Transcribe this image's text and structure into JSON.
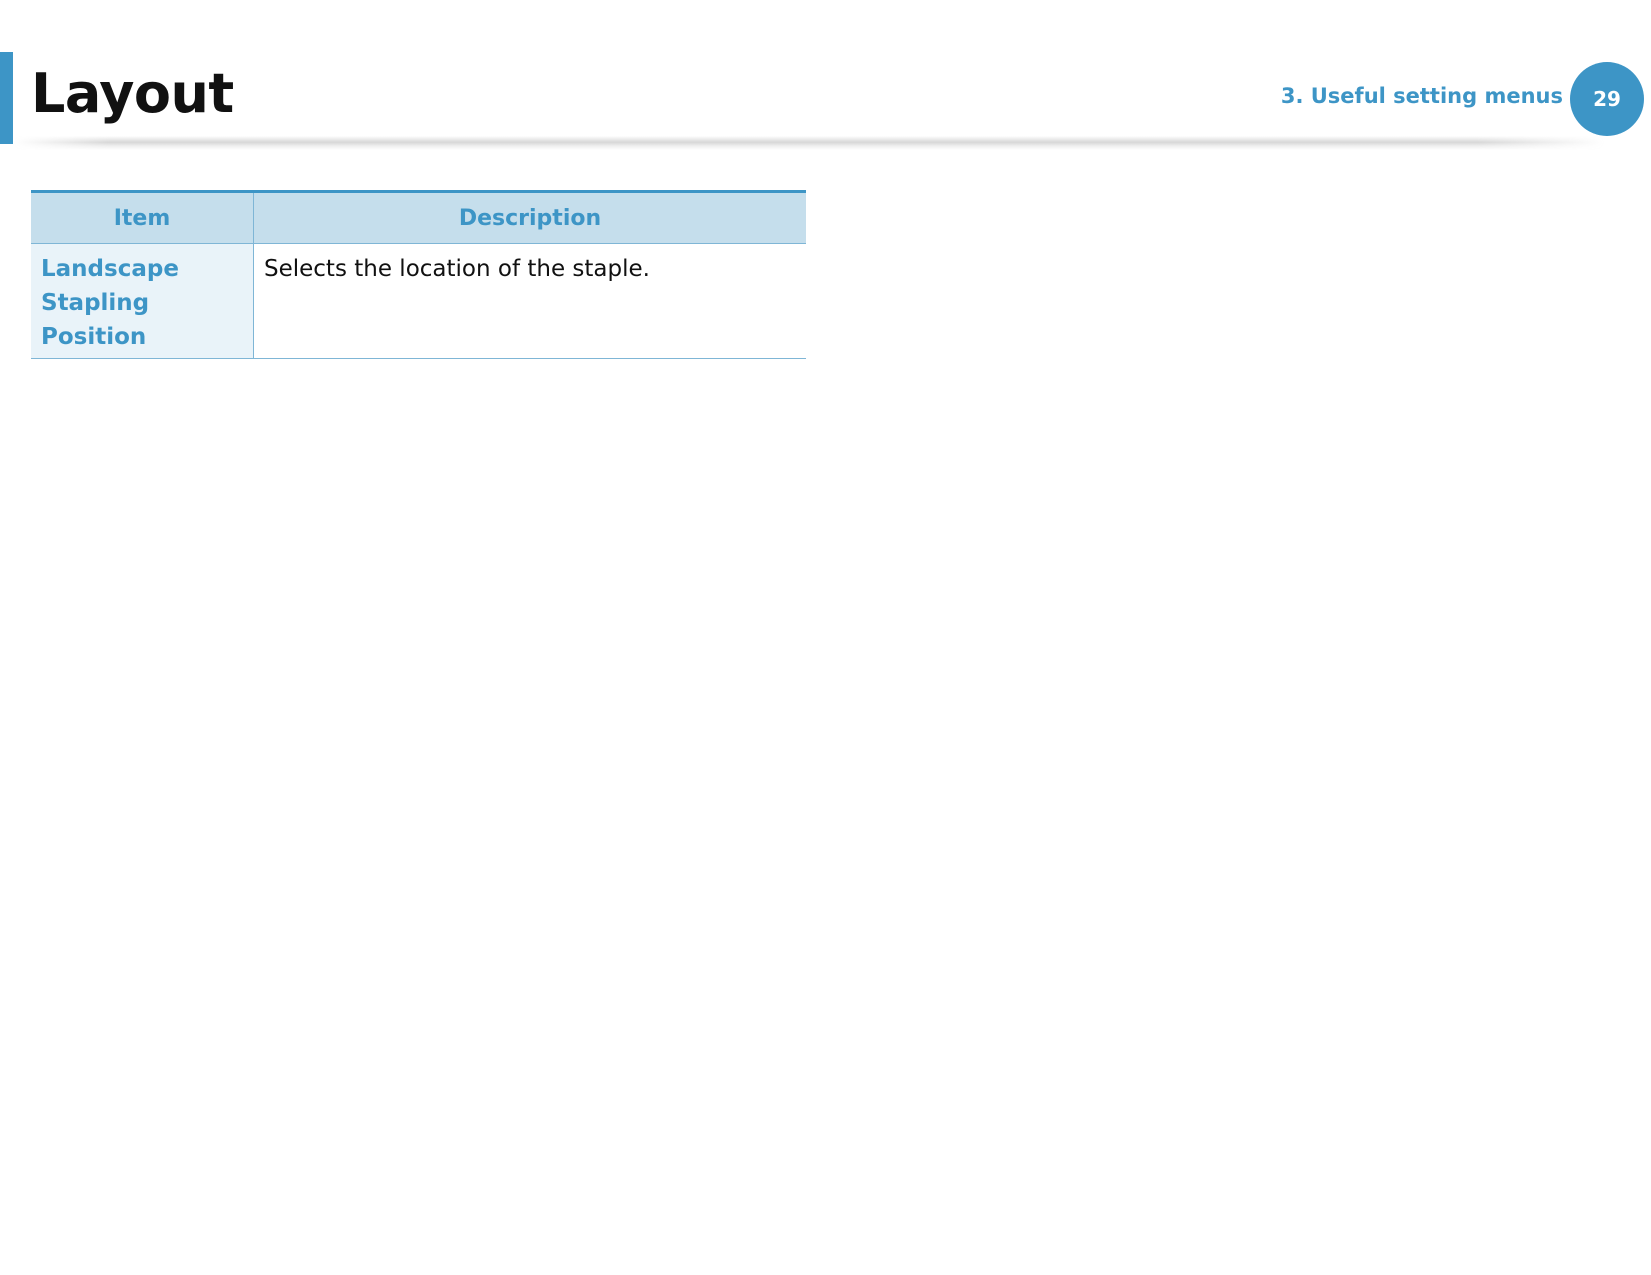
{
  "header": {
    "title": "Layout",
    "chapter": "3.  Useful setting menus",
    "page_number": "29",
    "accent_color": "#3d95c6"
  },
  "table": {
    "columns": [
      "Item",
      "Description"
    ],
    "rows": [
      {
        "item": "Landscape Stapling Position",
        "description": "Selects the location of the staple."
      }
    ]
  }
}
